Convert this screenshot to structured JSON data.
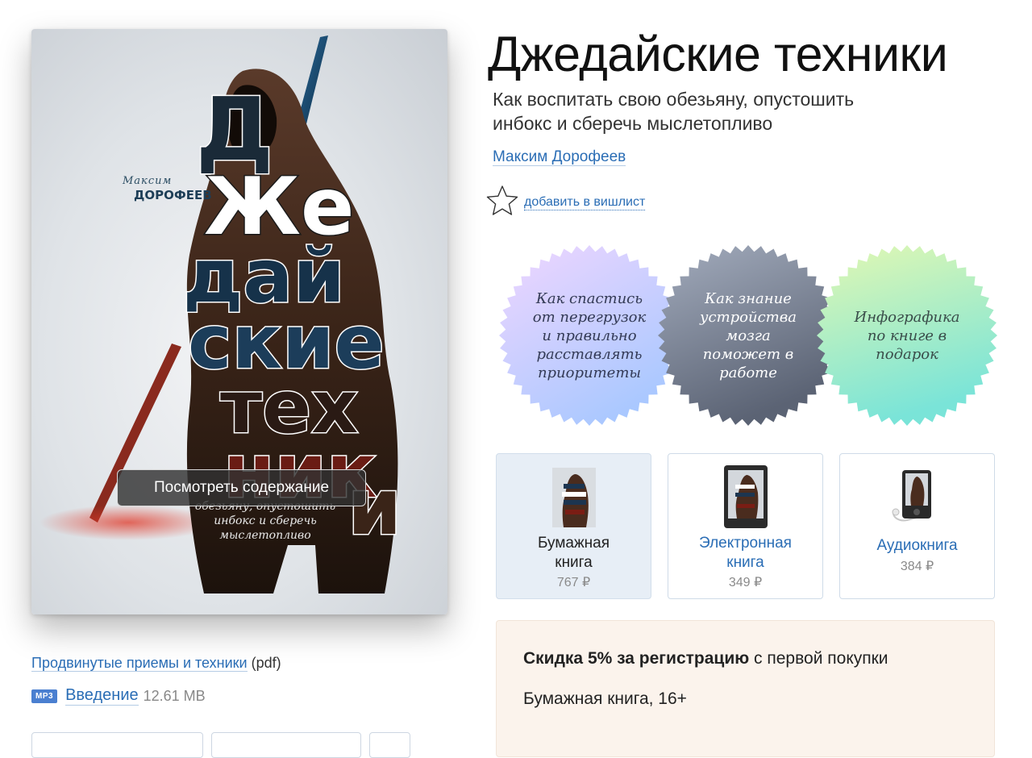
{
  "cover": {
    "author_first": "Максим",
    "author_last": "ДОРОФЕЕВ",
    "title_words": [
      "Д",
      "Же",
      "дай",
      "ские",
      "тех",
      "ник",
      "и"
    ],
    "tagline": "обезьяну, опустошить инбокс и сберечь мыслетопливо",
    "toc_button": "Посмотреть содержание"
  },
  "book": {
    "title": "Джедайские техники",
    "subtitle": "Как воспитать свою обезьяну, опустошить инбокс и сберечь мыслетопливо",
    "author": "Максим Дорофеев",
    "wishlist_label": "добавить в вишлист"
  },
  "badges": [
    {
      "text": "Как спастись от перегрузок и правильно расставлять приоритеты",
      "colors": [
        "#f3d9ff",
        "#b9d3ff"
      ],
      "text_color": "#333a55"
    },
    {
      "text": "Как знание устройства мозга поможет в работе",
      "colors": [
        "#9aa3b4",
        "#5e6678"
      ],
      "text_color": "#ffffff"
    },
    {
      "text": "Инфографика по книге в подарок",
      "colors": [
        "#dff7b0",
        "#7de6d6"
      ],
      "text_color": "#3a4d4a"
    }
  ],
  "formats": [
    {
      "name": "Бумажная книга",
      "price": "767 ₽",
      "active": true
    },
    {
      "name": "Электронная книга",
      "price": "349 ₽",
      "active": false
    },
    {
      "name": "Аудиокнига",
      "price": "384 ₽",
      "active": false
    }
  ],
  "extras": {
    "pdf_link": "Продвинутые приемы и техники",
    "pdf_ext": "(pdf)",
    "mp3_badge": "MP3",
    "mp3_link": "Введение",
    "mp3_size": "12.61 MB"
  },
  "promo": {
    "discount_bold": "Скидка 5% за регистрацию",
    "discount_rest": " с первой покупки",
    "format_info": "Бумажная книга, 16+"
  },
  "colors": {
    "link": "#2a6db5",
    "active_card": "#e7eef6",
    "promo_bg": "#fbf3ec"
  }
}
